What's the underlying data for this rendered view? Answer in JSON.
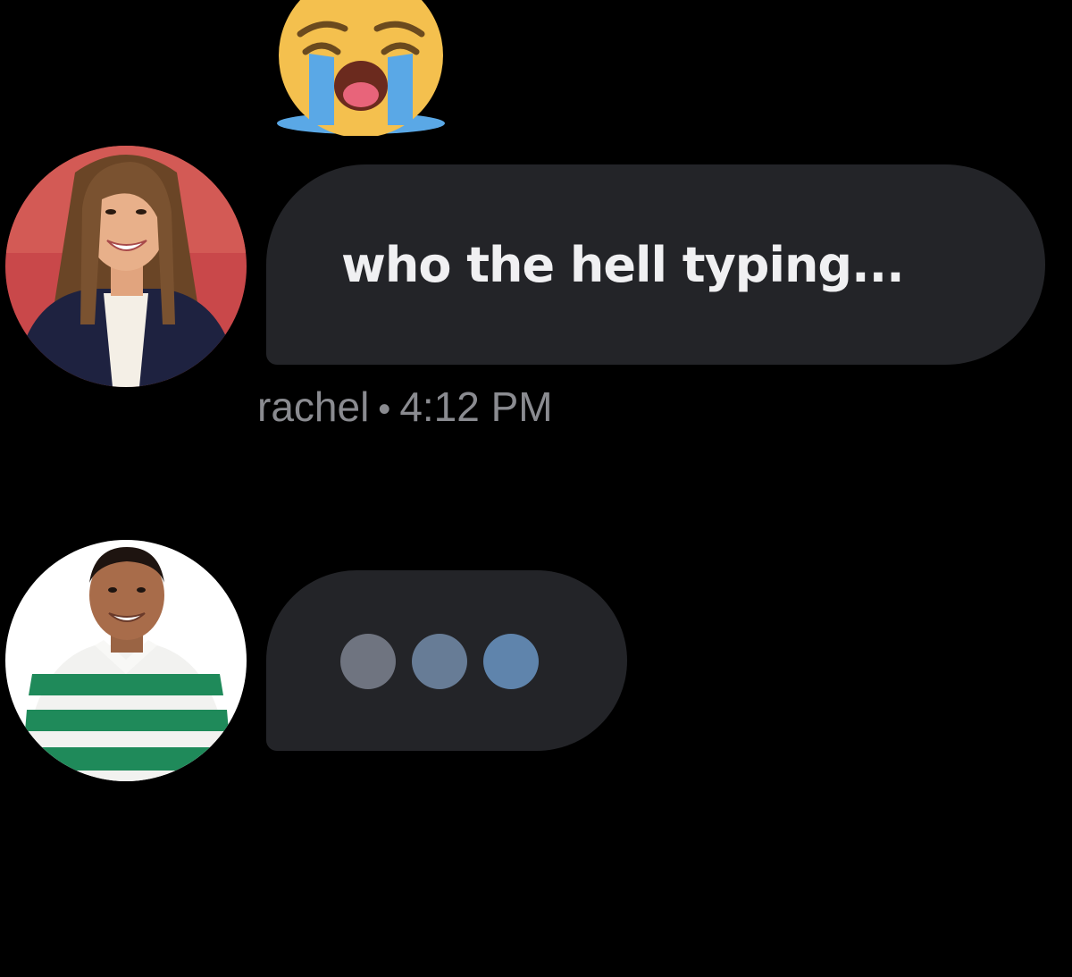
{
  "reaction": {
    "icon": "loudly-crying-face-icon"
  },
  "messages": [
    {
      "author": "rachel",
      "text": "who the hell typing...",
      "timestamp": "4:12 PM",
      "separator": "•",
      "avatar_icon": "avatar-rachel"
    }
  ],
  "typing_indicator": {
    "avatar_icon": "avatar-typing-user",
    "dot_colors": [
      "#6f7480",
      "#677c96",
      "#5f84ac"
    ]
  },
  "colors": {
    "background": "#000000",
    "bubble": "#232428",
    "message_text": "#f0f0f2",
    "meta_text": "#8a8b90"
  }
}
